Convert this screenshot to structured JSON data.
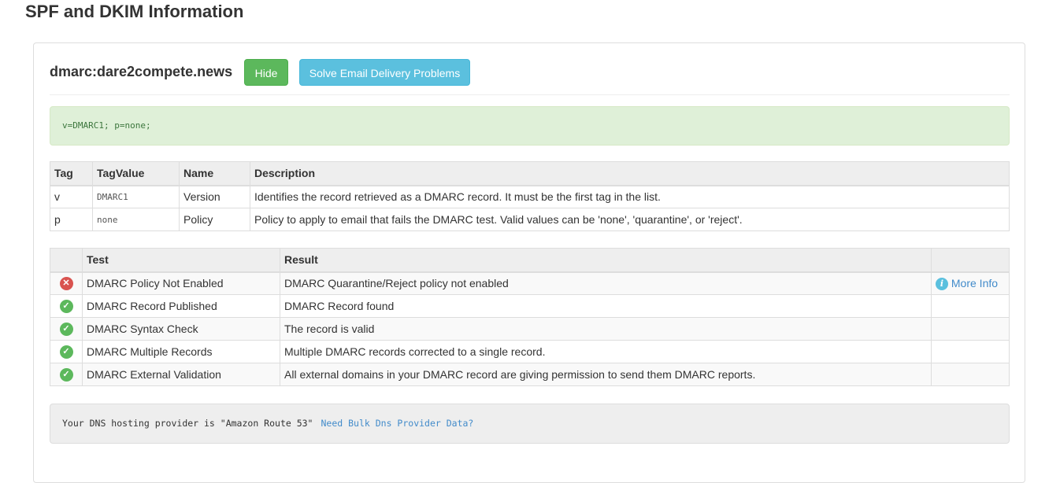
{
  "page_title": "SPF and DKIM Information",
  "header": {
    "domain": "dmarc:dare2compete.news",
    "hide_label": "Hide",
    "solve_label": "Solve Email Delivery Problems"
  },
  "record": "v=DMARC1; p=none;",
  "tag_table": {
    "headers": {
      "tag": "Tag",
      "value": "TagValue",
      "name": "Name",
      "description": "Description"
    },
    "rows": [
      {
        "tag": "v",
        "value": "DMARC1",
        "name": "Version",
        "description": "Identifies the record retrieved as a DMARC record. It must be the first tag in the list."
      },
      {
        "tag": "p",
        "value": "none",
        "name": "Policy",
        "description": "Policy to apply to email that fails the DMARC test. Valid values can be 'none', 'quarantine', or 'reject'."
      }
    ]
  },
  "test_table": {
    "headers": {
      "status": "",
      "test": "Test",
      "result": "Result",
      "info": ""
    },
    "rows": [
      {
        "status": "error",
        "icon": "x-circle-icon",
        "test": "DMARC Policy Not Enabled",
        "result": "DMARC Quarantine/Reject policy not enabled",
        "more_info": "More Info"
      },
      {
        "status": "ok",
        "icon": "check-circle-icon",
        "test": "DMARC Record Published",
        "result": "DMARC Record found",
        "more_info": ""
      },
      {
        "status": "ok",
        "icon": "check-circle-icon",
        "test": "DMARC Syntax Check",
        "result": "The record is valid",
        "more_info": ""
      },
      {
        "status": "ok",
        "icon": "check-circle-icon",
        "test": "DMARC Multiple Records",
        "result": "Multiple DMARC records corrected to a single record.",
        "more_info": ""
      },
      {
        "status": "ok",
        "icon": "check-circle-icon",
        "test": "DMARC External Validation",
        "result": "All external domains in your DMARC record are giving permission to send them DMARC reports.",
        "more_info": ""
      }
    ]
  },
  "dns": {
    "text": "Your DNS hosting provider is \"Amazon Route 53\"",
    "link": "Need Bulk Dns Provider Data?"
  },
  "colors": {
    "ok": "#5cb85c",
    "error": "#d9534f",
    "info": "#5bc0de",
    "link": "#428bca"
  }
}
